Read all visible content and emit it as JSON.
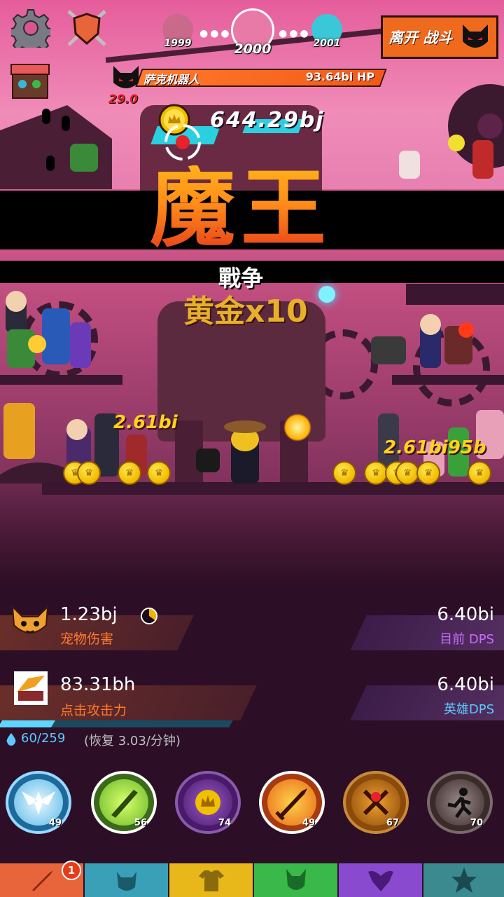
{
  "hud": {
    "stages": {
      "prev": "1999",
      "current": "2000",
      "next": "2001"
    },
    "leave_button": "离开 战斗",
    "boss": {
      "name": "萨克机器人",
      "hp": "93.64bi HP",
      "timer": "29.0"
    },
    "gold": "644.29bj"
  },
  "banner": {
    "title": "魔王",
    "subtitle": "戰争",
    "bonus": "黄金x10"
  },
  "battle": {
    "damage_left": "2.61bi",
    "damage_right": "2.61bi",
    "damage_right_tail": "95b"
  },
  "stats": {
    "pet_damage_value": "1.23bj",
    "pet_damage_label": "宠物伤害",
    "tap_damage_value": "83.31bh",
    "tap_damage_label": "点击攻击力",
    "current_dps_value": "6.40bi",
    "current_dps_label": "目前 DPS",
    "hero_dps_value": "6.40bi",
    "hero_dps_label": "英雄DPS"
  },
  "mana": {
    "text": "60/259",
    "regen": "(恢复 3.03/分钟)",
    "fraction": 0.23
  },
  "skills": [
    {
      "name": "heavenly-strike",
      "level": "49",
      "color": "#2a8fd0"
    },
    {
      "name": "shadow-clone",
      "level": "56",
      "color": "#7ab82a"
    },
    {
      "name": "hand-of-midas",
      "level": "74",
      "color": "#6a2c8a"
    },
    {
      "name": "fire-sword",
      "level": "49",
      "color": "#e86a1a"
    },
    {
      "name": "war-cry",
      "level": "67",
      "color": "#c87a10"
    },
    {
      "name": "deadly-strike",
      "level": "70",
      "color": "#5a4a4a"
    }
  ],
  "tabs": [
    {
      "name": "sword",
      "color": "#e8643a",
      "badge": "1"
    },
    {
      "name": "heroes",
      "color": "#3aa0b8"
    },
    {
      "name": "equipment",
      "color": "#e8b81a"
    },
    {
      "name": "pets",
      "color": "#3ab84a"
    },
    {
      "name": "clan",
      "color": "#8a4ad0"
    },
    {
      "name": "shop",
      "color": "#3a8a90"
    }
  ]
}
